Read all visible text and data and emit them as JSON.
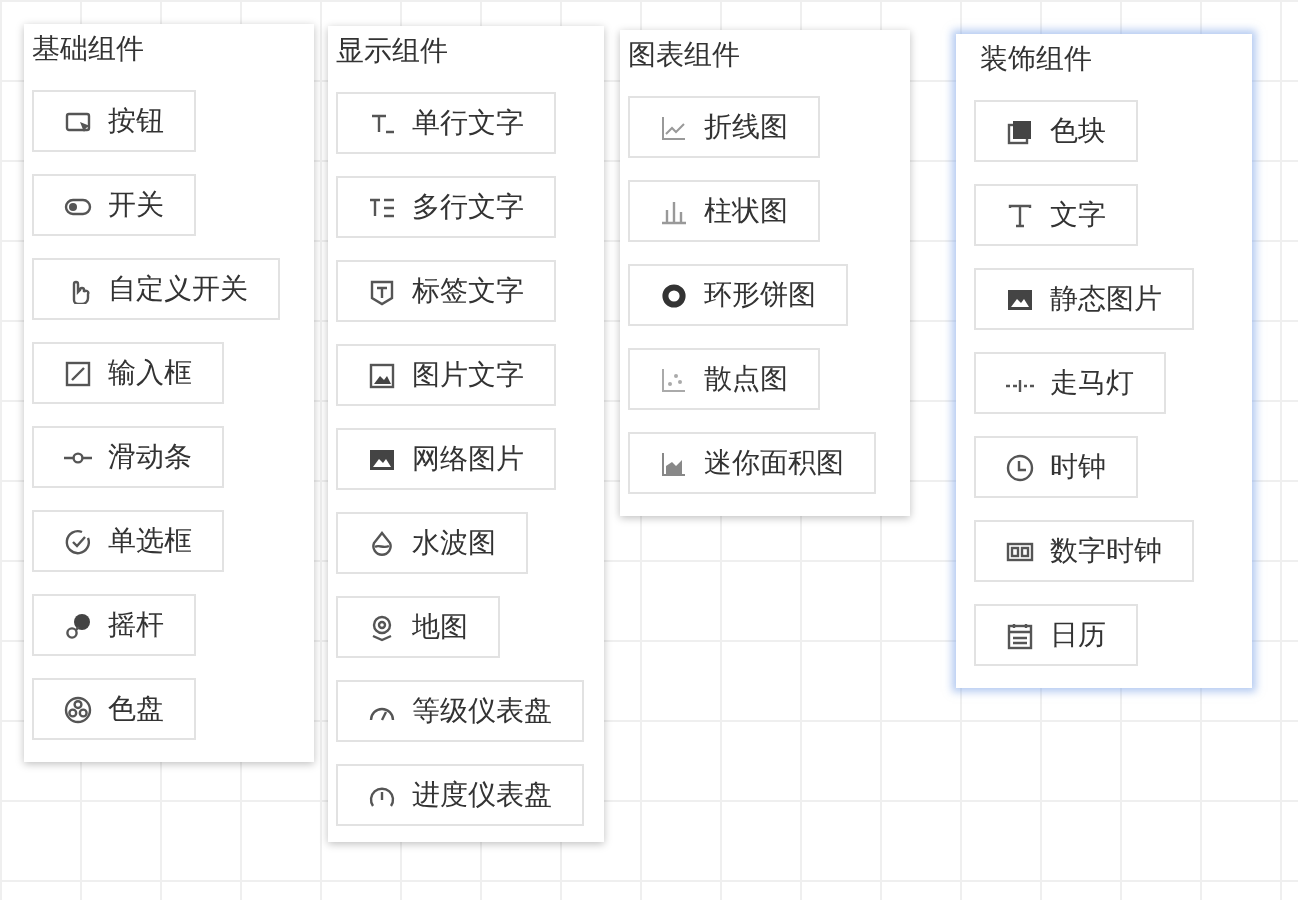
{
  "panels": [
    {
      "title": "基础组件",
      "selected": false,
      "items": [
        "按钮",
        "开关",
        "自定义开关",
        "输入框",
        "滑动条",
        "单选框",
        "摇杆",
        "色盘"
      ]
    },
    {
      "title": "显示组件",
      "selected": false,
      "items": [
        "单行文字",
        "多行文字",
        "标签文字",
        "图片文字",
        "网络图片",
        "水波图",
        "地图",
        "等级仪表盘",
        "进度仪表盘"
      ]
    },
    {
      "title": "图表组件",
      "selected": false,
      "items": [
        "折线图",
        "柱状图",
        "环形饼图",
        "散点图",
        "迷你面积图"
      ]
    },
    {
      "title": "装饰组件",
      "selected": true,
      "items": [
        "色块",
        "文字",
        "静态图片",
        "走马灯",
        "时钟",
        "数字时钟",
        "日历"
      ]
    }
  ]
}
